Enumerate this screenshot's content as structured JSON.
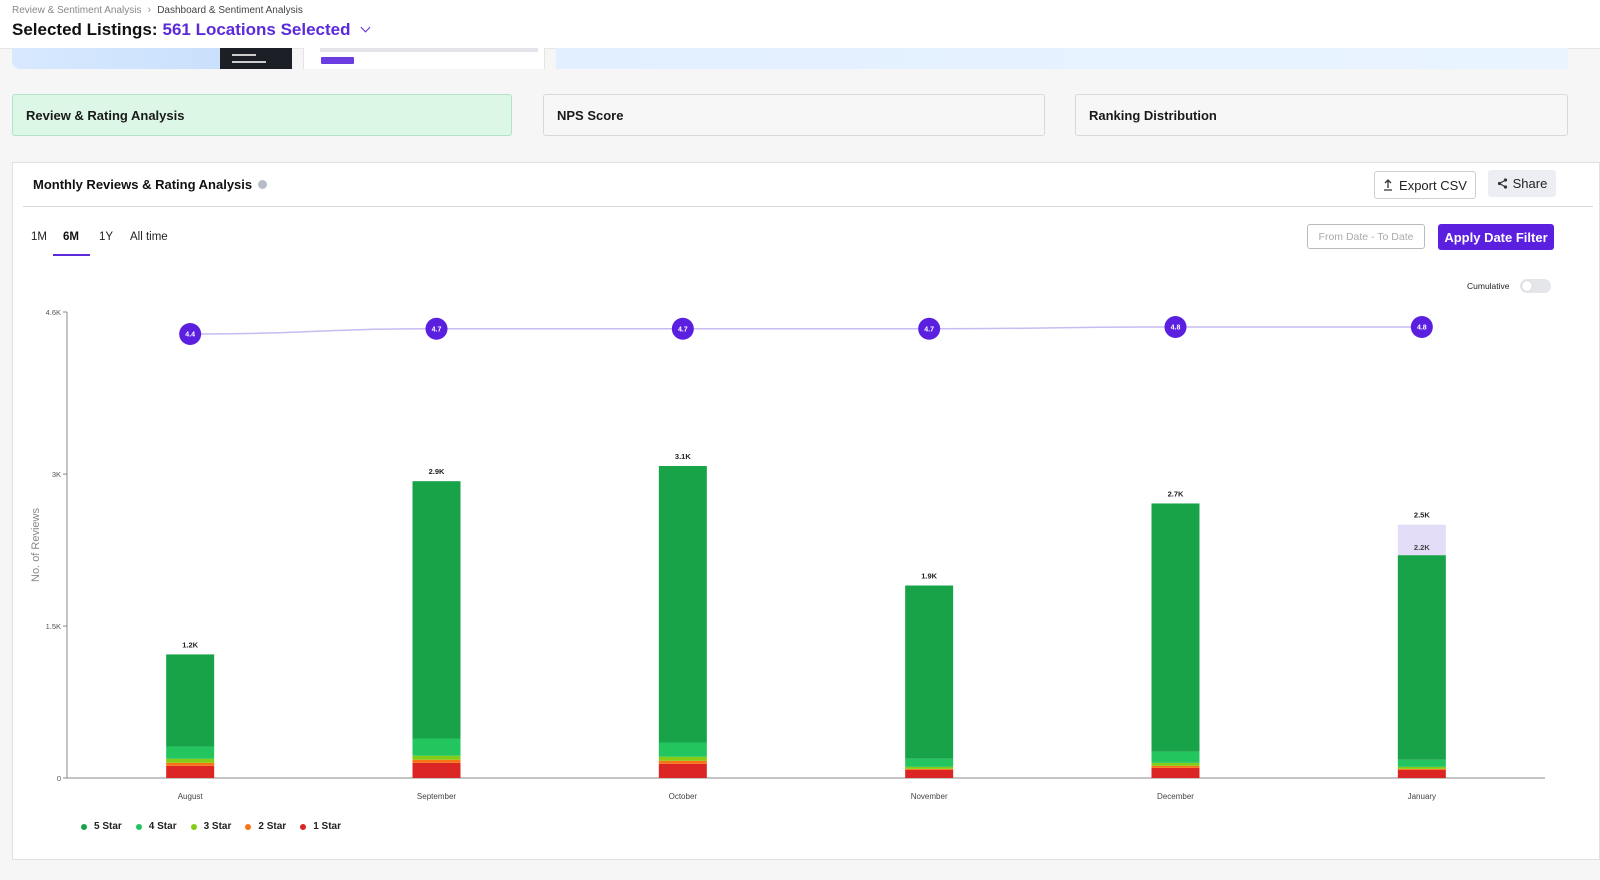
{
  "breadcrumb": [
    "Review & Sentiment Analysis",
    "Dashboard & Sentiment Analysis"
  ],
  "header": {
    "label": "Selected Listings:",
    "value": "561 Locations Selected"
  },
  "tabs": [
    {
      "label": "Review & Rating Analysis",
      "active": true
    },
    {
      "label": "NPS Score",
      "active": false
    },
    {
      "label": "Ranking Distribution",
      "active": false
    }
  ],
  "panel": {
    "title": "Monthly Reviews & Rating Analysis",
    "export_label": "Export CSV",
    "share_label": "Share",
    "ranges": [
      "1M",
      "6M",
      "1Y",
      "All time"
    ],
    "selected_range": "6M",
    "date_placeholder": "From Date - To Date",
    "apply_label": "Apply Date Filter",
    "cumulative_label": "Cumulative"
  },
  "colors": {
    "accent": "#5b1fe0",
    "five_star": "#18a349",
    "four_star": "#22c55e",
    "three_star": "#84cc16",
    "two_star": "#f97316",
    "one_star": "#dc2626"
  },
  "chart_data": {
    "type": "bar",
    "stacked": true,
    "categories": [
      "August",
      "September",
      "October",
      "November",
      "December",
      "January"
    ],
    "ylabel": "No. of Reviews",
    "ylim": [
      0,
      4600
    ],
    "yticks": [
      {
        "value": 0,
        "label": "0"
      },
      {
        "value": 1500,
        "label": "1.5K"
      },
      {
        "value": 3000,
        "label": "3K"
      },
      {
        "value": 4600,
        "label": "4.6K"
      }
    ],
    "series": [
      {
        "name": "5 Star",
        "color": "#18a349",
        "values": [
          910,
          2540,
          2730,
          1710,
          2450,
          2020
        ]
      },
      {
        "name": "4 Star",
        "color": "#22c55e",
        "values": [
          120,
          170,
          140,
          80,
          110,
          70
        ]
      },
      {
        "name": "3 Star",
        "color": "#84cc16",
        "values": [
          40,
          40,
          40,
          20,
          30,
          20
        ]
      },
      {
        "name": "2 Star",
        "color": "#f97316",
        "values": [
          30,
          30,
          30,
          10,
          20,
          10
        ]
      },
      {
        "name": "1 Star",
        "color": "#dc2626",
        "values": [
          120,
          150,
          140,
          80,
          100,
          80
        ]
      }
    ],
    "extra": {
      "category": "January",
      "value": 300,
      "color": "#e4ddf7"
    },
    "total_labels": [
      "1.2K",
      "2.9K",
      "3.1K",
      "1.9K",
      "2.7K",
      "2.5K"
    ],
    "inner_label": {
      "category": "January",
      "label": "2.2K"
    },
    "rating_line": {
      "values": [
        4.4,
        4.7,
        4.7,
        4.7,
        4.8,
        4.8
      ],
      "labels": [
        "4.4",
        "4.7",
        "4.7",
        "4.7",
        "4.8",
        "4.8"
      ],
      "color": "#5b1fe0"
    },
    "legend": [
      "5 Star",
      "4 Star",
      "3 Star",
      "2 Star",
      "1 Star"
    ],
    "legend_position": "bottom-left"
  }
}
